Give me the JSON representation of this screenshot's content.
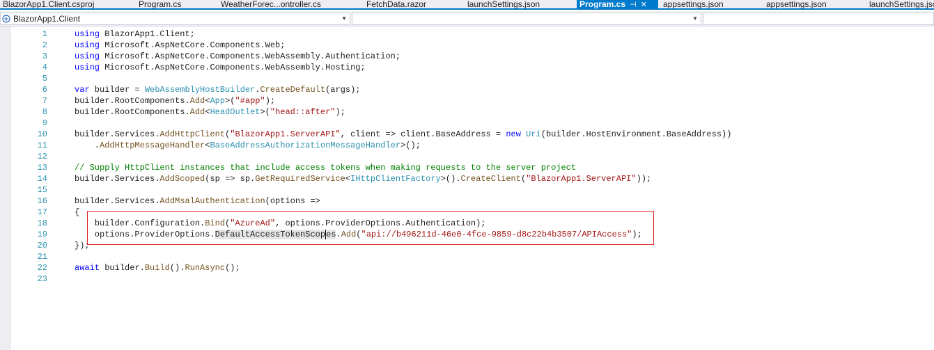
{
  "tabs": [
    {
      "label": "BlazorApp1.Client.csproj",
      "active": false
    },
    {
      "label": "Program.cs",
      "active": false
    },
    {
      "label": "WeatherForec...ontroller.cs",
      "active": false
    },
    {
      "label": "FetchData.razor",
      "active": false
    },
    {
      "label": "launchSettings.json",
      "active": false
    },
    {
      "label": "Program.cs",
      "active": true,
      "pin": "⊣",
      "close": "✕"
    },
    {
      "label": "appsettings.json",
      "active": false
    },
    {
      "label": "appsettings.json",
      "active": false
    },
    {
      "label": "launchSettings.json",
      "active": false
    }
  ],
  "navbar": {
    "project": "BlazorApp1.Client",
    "type_member": "",
    "member": ""
  },
  "editor": {
    "lines": [
      {
        "n": "1",
        "code": "using BlazorApp1.Client;"
      },
      {
        "n": "2",
        "code": "using Microsoft.AspNetCore.Components.Web;"
      },
      {
        "n": "3",
        "code": "using Microsoft.AspNetCore.Components.WebAssembly.Authentication;"
      },
      {
        "n": "4",
        "code": "using Microsoft.AspNetCore.Components.WebAssembly.Hosting;"
      },
      {
        "n": "5",
        "code": ""
      },
      {
        "n": "6",
        "code": "var builder = WebAssemblyHostBuilder.CreateDefault(args);"
      },
      {
        "n": "7",
        "code": "builder.RootComponents.Add<App>(\"#app\");"
      },
      {
        "n": "8",
        "code": "builder.RootComponents.Add<HeadOutlet>(\"head::after\");"
      },
      {
        "n": "9",
        "code": ""
      },
      {
        "n": "10",
        "code": "builder.Services.AddHttpClient(\"BlazorApp1.ServerAPI\", client => client.BaseAddress = new Uri(builder.HostEnvironment.BaseAddress))"
      },
      {
        "n": "11",
        "code": "    .AddHttpMessageHandler<BaseAddressAuthorizationMessageHandler>();"
      },
      {
        "n": "12",
        "code": ""
      },
      {
        "n": "13",
        "code": "// Supply HttpClient instances that include access tokens when making requests to the server project"
      },
      {
        "n": "14",
        "code": "builder.Services.AddScoped(sp => sp.GetRequiredService<IHttpClientFactory>().CreateClient(\"BlazorApp1.ServerAPI\"));"
      },
      {
        "n": "15",
        "code": ""
      },
      {
        "n": "16",
        "code": "builder.Services.AddMsalAuthentication(options =>"
      },
      {
        "n": "17",
        "code": "{"
      },
      {
        "n": "18",
        "code": "    builder.Configuration.Bind(\"AzureAd\", options.ProviderOptions.Authentication);"
      },
      {
        "n": "19",
        "code": "    options.ProviderOptions.DefaultAccessTokenScopes.Add(\"api://b496211d-46e0-4fce-9859-d8c22b4b3507/APIAccess\");"
      },
      {
        "n": "20",
        "code": "});"
      },
      {
        "n": "21",
        "code": ""
      },
      {
        "n": "22",
        "code": "await builder.Build().RunAsync();"
      },
      {
        "n": "23",
        "code": ""
      }
    ]
  },
  "colors": {
    "keyword": "#0000ff",
    "type": "#2b91af",
    "method": "#74531f",
    "string": "#a31515",
    "comment": "#008000",
    "accent": "#007acc",
    "annotation": "#e02020"
  }
}
